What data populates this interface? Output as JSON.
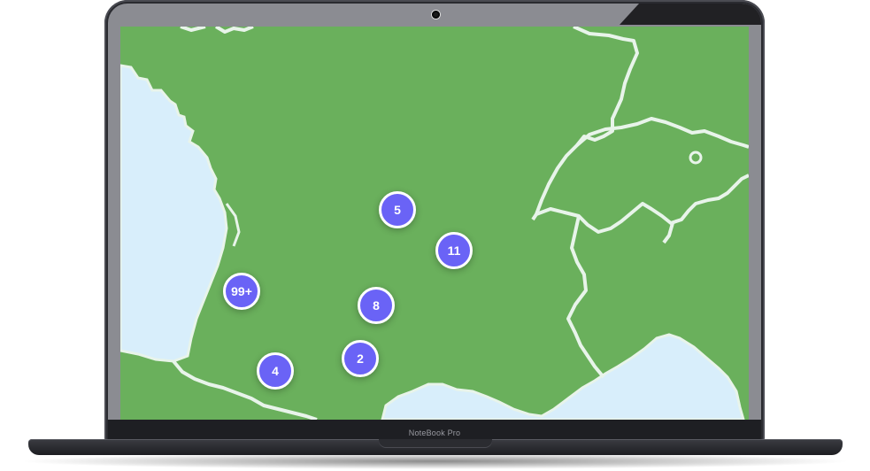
{
  "device": {
    "brand_label": "NoteBook Pro"
  },
  "map": {
    "land_color": "#6ab05c",
    "water_color": "#d8eefb",
    "border_color": "#e8f4ea",
    "clusters": [
      {
        "id": "cluster-5",
        "count": "5"
      },
      {
        "id": "cluster-11",
        "count": "11"
      },
      {
        "id": "cluster-99plus",
        "count": "99+"
      },
      {
        "id": "cluster-8",
        "count": "8"
      },
      {
        "id": "cluster-2",
        "count": "2"
      },
      {
        "id": "cluster-4",
        "count": "4"
      }
    ],
    "cluster_color": "#6a63f6"
  }
}
